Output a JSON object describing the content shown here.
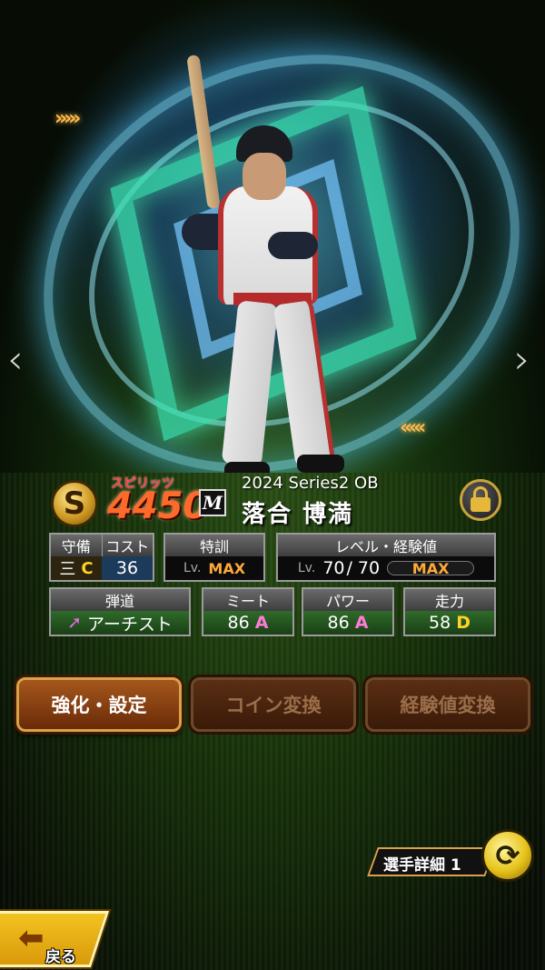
{
  "player": {
    "series": "2024 Series2 OB",
    "name": "落合 博満",
    "team_logo_letter": "M",
    "spirit_label": "スピリッツ",
    "spirit_value": "4450",
    "rank_badge": "S"
  },
  "stats_row1": {
    "defense": {
      "label": "守備",
      "position": "三",
      "grade": "C"
    },
    "cost": {
      "label": "コスト",
      "value": "36"
    },
    "special": {
      "label": "特訓",
      "lv": "Lv.",
      "value": "MAX"
    },
    "level": {
      "label": "レベル・経験値",
      "lv": "Lv.",
      "current": "70",
      "sep": "/",
      "max": "70",
      "exp_label": "MAX"
    }
  },
  "stats_row2": {
    "trajectory": {
      "label": "弾道",
      "value": "アーチスト"
    },
    "meet": {
      "label": "ミート",
      "value": "86",
      "grade": "A"
    },
    "power": {
      "label": "パワー",
      "value": "86",
      "grade": "A"
    },
    "speed": {
      "label": "走力",
      "value": "58",
      "grade": "D"
    }
  },
  "buttons": {
    "enhance": "強化・設定",
    "coin": "コイン変換",
    "exp": "経験値変換"
  },
  "detail": {
    "label": "選手詳細 1"
  },
  "back": {
    "label": "戻る"
  },
  "nav": {
    "left": "‹",
    "right": "›"
  },
  "colors": {
    "accent_gold": "#d9a24a",
    "grade_a": "#ff7ad8",
    "grade_c": "#ffd12a",
    "max_orange": "#ffa93a",
    "spirit_red": "#ff6a2a"
  }
}
